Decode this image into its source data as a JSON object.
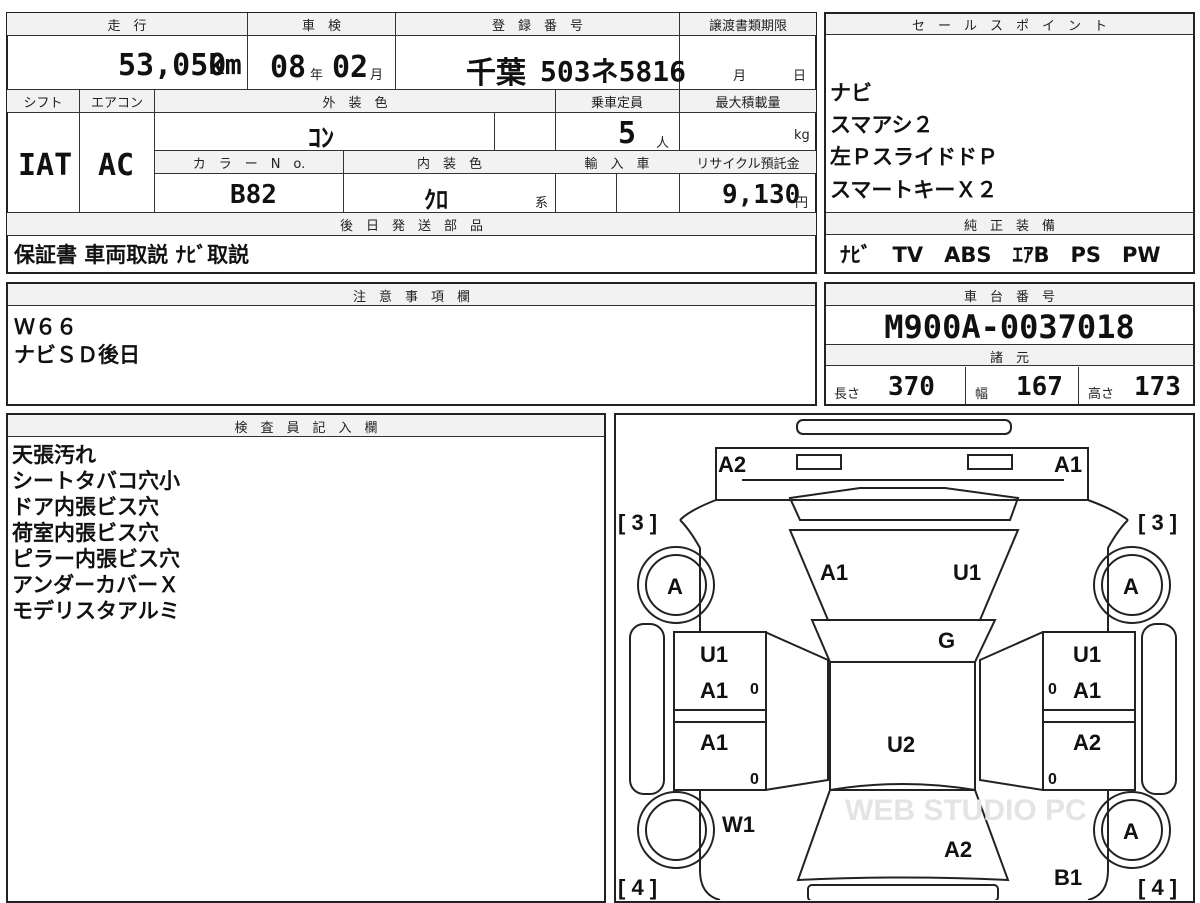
{
  "top_table": {
    "headers": {
      "mileage": "走　行",
      "inspection": "車　検",
      "registration": "登　録　番　号",
      "transfer_deadline": "譲渡書類期限",
      "shift": "シフト",
      "aircon": "エアコン",
      "exterior": "外　装　色",
      "capacity": "乗車定員",
      "max_load": "最大積載量",
      "color_no": "カ　ラ　ー　N　o.",
      "interior": "内　装　色",
      "import": "輸　入　車",
      "recycle": "リサイクル預託金",
      "later_parts": "後　日　発　送　部　品"
    },
    "mileage_value": "53,050",
    "mileage_unit": "km",
    "inspection_year": "08",
    "inspection_year_unit": "年",
    "inspection_month": "02",
    "inspection_month_unit": "月",
    "plate_region": "千葉",
    "plate_number": "503ネ5816",
    "transfer_month_unit": "月",
    "transfer_day_unit": "日",
    "shift_value": "IAT",
    "aircon_value": "AC",
    "exterior_value": "ｺﾝ",
    "capacity_value": "5",
    "capacity_unit": "人",
    "max_load_unit": "kg",
    "color_no_value": "B82",
    "interior_value": "ｸﾛ",
    "interior_unit": "系",
    "recycle_value": "9,130",
    "recycle_unit": "円",
    "later_parts_value": "保証書 車両取説 ﾅﾋﾞ取説"
  },
  "sales_points": {
    "header": "セ　ー　ル　ス　ポ　イ　ン　ト",
    "items": [
      "ナビ",
      "スマアシ２",
      "左ＰスライドドＰ",
      "スマートキーＸ２"
    ]
  },
  "genuine_equipment": {
    "header": "純　正　装　備",
    "value": "ﾅﾋﾞ　TV　ABS　ｴｱB　PS　PW"
  },
  "notes": {
    "header": "注　意　事　項　欄",
    "lines": [
      "Ｗ６６",
      "ナビＳＤ後日"
    ]
  },
  "chassis": {
    "header": "車　台　番　号",
    "value": "M900A-0037018",
    "spec_header": "諸　元",
    "length_label": "長さ",
    "length_value": "370",
    "width_label": "幅",
    "width_value": "167",
    "height_label": "高さ",
    "height_value": "173"
  },
  "inspector": {
    "header": "検　査　員　記　入　欄",
    "lines": [
      "天張汚れ",
      "シートタバコ穴小",
      "ドア内張ビス穴",
      "荷室内張ビス穴",
      "ピラー内張ビス穴",
      "アンダーカバーＸ",
      "モデリスタアルミ"
    ]
  },
  "diagram": {
    "marks": {
      "rear_left": "A2",
      "rear_right": "A1",
      "bracket_left_top": "[ 3 ]",
      "bracket_right_top": "[ 3 ]",
      "bracket_left_bottom": "[ 4 ]",
      "bracket_right_bottom": "[ 4 ]",
      "wheel_rl": "A",
      "wheel_rr": "A",
      "wheel_fr": "A",
      "roof_left": "A1",
      "roof_right": "U1",
      "rear_glass": "G",
      "door_rl_1": "U1",
      "door_rl_2": "A1",
      "door_rl_3": "0",
      "door_rr_1": "U1",
      "door_rr_2": "A1",
      "door_rr_3": "0",
      "door_fl_1": "A1",
      "door_fl_2": "0",
      "door_fr_1": "A2",
      "door_fr_2": "0",
      "center": "U2",
      "fender_fl": "W1",
      "hood": "A2",
      "bumper_fr": "B1"
    },
    "watermark": "WEB STUDIO PC"
  }
}
